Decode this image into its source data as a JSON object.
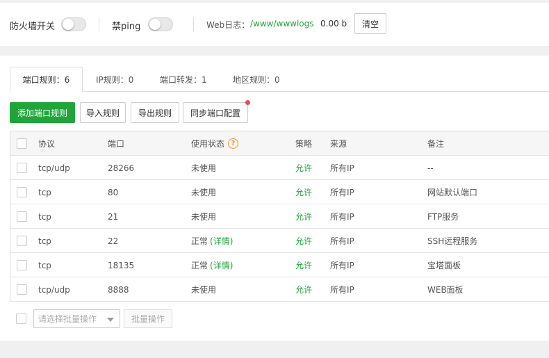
{
  "topbar": {
    "firewall_label": "防火墙开关",
    "firewall_on": false,
    "ping_label": "禁ping",
    "ping_on": false,
    "weblog_label": "Web日志：",
    "weblog_path": "/www/wwwlogs",
    "weblog_size": "0.00 b",
    "clear_label": "清空"
  },
  "tabs": [
    {
      "label": "端口规则：6",
      "active": true
    },
    {
      "label": "IP规则：0",
      "active": false
    },
    {
      "label": "端口转发：1",
      "active": false
    },
    {
      "label": "地区规则：0",
      "active": false
    }
  ],
  "toolbar": {
    "add_label": "添加端口规则",
    "import_label": "导入规则",
    "export_label": "导出规则",
    "sync_label": "同步端口配置"
  },
  "table": {
    "headers": {
      "protocol": "协议",
      "port": "端口",
      "status": "使用状态",
      "status_help": "?",
      "policy": "策略",
      "source": "来源",
      "remark": "备注"
    },
    "rows": [
      {
        "protocol": "tcp/udp",
        "port": "28266",
        "status": "未使用",
        "detail": "",
        "policy": "允许",
        "source": "所有IP",
        "remark": "--"
      },
      {
        "protocol": "tcp",
        "port": "80",
        "status": "未使用",
        "detail": "",
        "policy": "允许",
        "source": "所有IP",
        "remark": "网站默认端口"
      },
      {
        "protocol": "tcp",
        "port": "21",
        "status": "未使用",
        "detail": "",
        "policy": "允许",
        "source": "所有IP",
        "remark": "FTP服务"
      },
      {
        "protocol": "tcp",
        "port": "22",
        "status": "正常",
        "detail": "(详情)",
        "policy": "允许",
        "source": "所有IP",
        "remark": "SSH远程服务"
      },
      {
        "protocol": "tcp",
        "port": "18135",
        "status": "正常",
        "detail": "(详情)",
        "policy": "允许",
        "source": "所有IP",
        "remark": "宝塔面板"
      },
      {
        "protocol": "tcp/udp",
        "port": "8888",
        "status": "未使用",
        "detail": "",
        "policy": "允许",
        "source": "所有IP",
        "remark": "WEB面板"
      }
    ]
  },
  "footer": {
    "batch_select_placeholder": "请选择批量操作",
    "batch_button_label": "批量操作"
  },
  "colors": {
    "accent": "#20a53a",
    "warning": "#f0961e",
    "notify_dot": "#ef4b4b"
  }
}
